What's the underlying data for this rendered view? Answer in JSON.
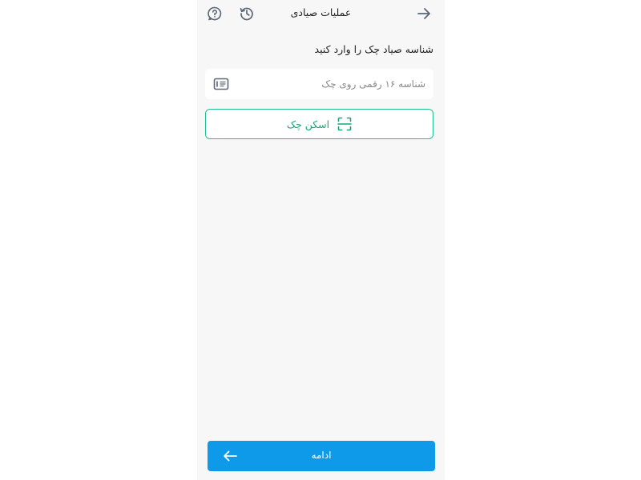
{
  "header": {
    "title": "عملیات صیادی",
    "back_icon": "arrow-right-icon",
    "history_icon": "history-icon",
    "help_icon": "help-icon"
  },
  "form": {
    "label": "شناسه صیاد چک را وارد کنید",
    "input": {
      "value": "",
      "placeholder": "شناسه ۱۶ رقمی روی چک",
      "icon": "check-card-icon"
    },
    "scan_button": {
      "label": "اسکن چک",
      "icon": "scan-icon"
    }
  },
  "footer": {
    "continue_label": "ادامه",
    "continue_icon": "arrow-left-icon"
  },
  "colors": {
    "background": "#f7f7f7",
    "accent_green": "#1dbf8e",
    "primary_blue": "#0e9ae8"
  }
}
